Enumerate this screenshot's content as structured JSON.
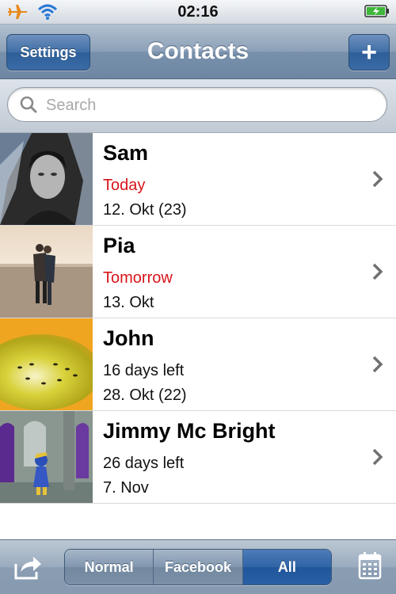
{
  "status": {
    "time": "02:16"
  },
  "nav": {
    "title": "Contacts",
    "settings_label": "Settings",
    "add_label": "+"
  },
  "search": {
    "placeholder": "Search"
  },
  "contacts": [
    {
      "name": "Sam",
      "line1": "Today",
      "line2": "12. Okt (23)"
    },
    {
      "name": "Pia",
      "line1": "Tomorrow",
      "line2": "13. Okt"
    },
    {
      "name": "John",
      "line1": "16 days left",
      "line2": "28. Okt (22)"
    },
    {
      "name": "Jimmy Mc Bright",
      "line1": "26 days left",
      "line2": "7. Nov"
    }
  ],
  "toolbar": {
    "segments": [
      "Normal",
      "Facebook",
      "All"
    ],
    "selected": "All"
  },
  "colors": {
    "highlight_red": "#d8141a",
    "nav_blue": "#6d87a3",
    "selected_segment": "#2f64a6"
  }
}
